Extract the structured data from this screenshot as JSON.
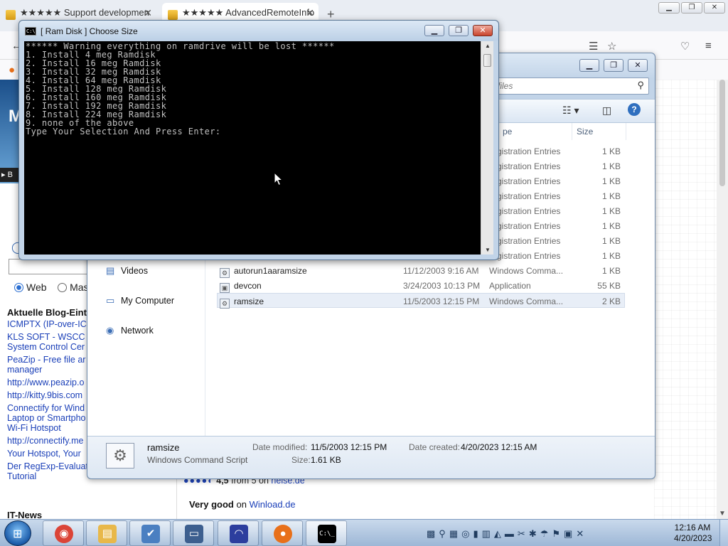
{
  "browser": {
    "tabs": [
      {
        "label": "★★★★★ Support developmen"
      },
      {
        "label": "★★★★★ AdvancedRemoteInfo"
      }
    ],
    "page": {
      "banner_letter": "M",
      "banner_bar": "▸ B",
      "radio_web": "Web",
      "radio_other": "Mas",
      "blog_heading": "Aktuelle Blog-Eint",
      "blog_links": [
        "ICMPTX (IP-over-ICM",
        "KLS SOFT - WSCC",
        "System Control Cer",
        "PeaZip - Free file ar",
        "manager",
        "http://www.peazip.o",
        "http://kitty.9bis.com",
        "Connectify for Wind",
        "Laptop or Smartpho",
        "Wi-Fi Hotspot",
        "http://connectify.me",
        "Your Hotspot, Your",
        "Der RegExp-Evaluator - RegExp-",
        "Tutorial"
      ],
      "it_news": "IT-News",
      "rating": {
        "score": "4,5",
        "from": "from 5 on",
        "site": "heise.de"
      },
      "verygood": {
        "label": "Very good",
        "on": "on",
        "site": "Winload.de"
      }
    }
  },
  "explorer": {
    "search_placeholder": "ch files",
    "columns": {
      "type": "pe",
      "size": "Size"
    },
    "nav": [
      {
        "label": "Videos",
        "icon": "video-folder-icon"
      },
      {
        "label": "My Computer",
        "icon": "computer-icon"
      },
      {
        "label": "Network",
        "icon": "network-icon"
      }
    ],
    "files": [
      {
        "name": "",
        "date": "",
        "type": "gistration Entries",
        "size": "1 KB"
      },
      {
        "name": "",
        "date": "",
        "type": "gistration Entries",
        "size": "1 KB"
      },
      {
        "name": "",
        "date": "",
        "type": "gistration Entries",
        "size": "1 KB"
      },
      {
        "name": "",
        "date": "",
        "type": "gistration Entries",
        "size": "1 KB"
      },
      {
        "name": "",
        "date": "",
        "type": "gistration Entries",
        "size": "1 KB"
      },
      {
        "name": "",
        "date": "",
        "type": "gistration Entries",
        "size": "1 KB"
      },
      {
        "name": "",
        "date": "",
        "type": "gistration Entries",
        "size": "1 KB"
      },
      {
        "name": "",
        "date": "",
        "type": "gistration Entries",
        "size": "1 KB"
      },
      {
        "name": "autorun1aaramsize",
        "date": "11/12/2003 9:16 AM",
        "type": "Windows Comma...",
        "size": "1 KB"
      },
      {
        "name": "devcon",
        "date": "3/24/2003 10:13 PM",
        "type": "Application",
        "size": "55 KB"
      },
      {
        "name": "ramsize",
        "date": "11/5/2003 12:15 PM",
        "type": "Windows Comma...",
        "size": "2 KB"
      }
    ],
    "details": {
      "name": "ramsize",
      "type": "Windows Command Script",
      "modified_label": "Date modified:",
      "modified": "11/5/2003 12:15 PM",
      "created_label": "Date created:",
      "created": "4/20/2023 12:15 AM",
      "size_label": "Size:",
      "size": "1.61 KB"
    }
  },
  "console": {
    "title": "[ Ram Disk ] Choose Size",
    "lines": [
      "****** Warning everything on ramdrive will be lost ******",
      "",
      "1. Install 4 meg Ramdisk",
      "2. Install 16 meg Ramdisk",
      "3. Install 32 meg Ramdisk",
      "4. Install 64 meg Ramdisk",
      "5. Install 128 meg Ramdisk",
      "6. Install 160 meg Ramdisk",
      "7. Install 192 meg Ramdisk",
      "8. Install 224 meg Ramdisk",
      "9. none of the above",
      "Type Your Selection And Press Enter:"
    ]
  },
  "taskbar": {
    "apps": [
      {
        "name": "chrome",
        "icon": "chrome-icon",
        "color": "#db4437"
      },
      {
        "name": "explorer",
        "icon": "folder-icon",
        "color": "#e8b84a"
      },
      {
        "name": "checklist",
        "icon": "checklist-icon",
        "color": "#4a7fc1"
      },
      {
        "name": "network-tool",
        "icon": "network-tool-icon",
        "color": "#3d5f8f"
      },
      {
        "name": "arc",
        "icon": "arc-icon",
        "color": "#2c3e9e"
      },
      {
        "name": "firefox",
        "icon": "firefox-icon",
        "color": "#e8701a"
      },
      {
        "name": "cmd",
        "icon": "cmd-icon",
        "color": "#000000"
      }
    ],
    "time": "12:16 AM",
    "date": "4/20/2023"
  }
}
